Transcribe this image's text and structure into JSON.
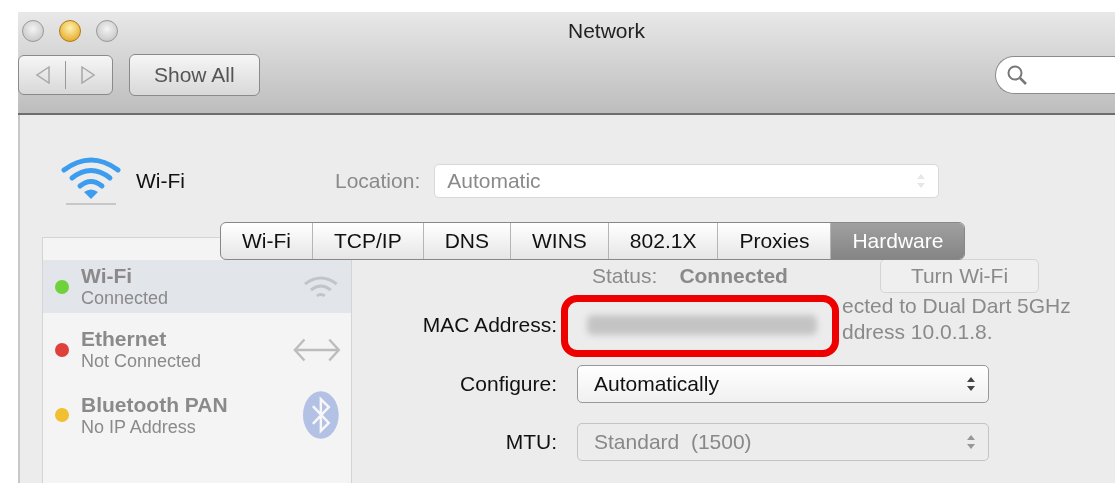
{
  "window": {
    "title": "Network"
  },
  "toolbar": {
    "show_all": "Show All"
  },
  "service": {
    "name": "Wi-Fi"
  },
  "location": {
    "label": "Location:",
    "value": "Automatic"
  },
  "services": [
    {
      "name": "Wi-Fi",
      "status": "Connected",
      "selected": true,
      "color": "#6fd13b",
      "kind": "wifi"
    },
    {
      "name": "Ethernet",
      "status": "Not Connected",
      "selected": false,
      "color": "#e0403a",
      "kind": "ethernet"
    },
    {
      "name": "Bluetooth PAN",
      "status": "No IP Address",
      "selected": false,
      "color": "#f0c030",
      "kind": "bluetooth"
    }
  ],
  "status": {
    "label": "Status:",
    "value": "Connected",
    "button": "Turn Wi-Fi"
  },
  "status_details": [
    "ected to Dual Dart 5GHz",
    "ddress 10.0.1.8."
  ],
  "tabs": [
    {
      "label": "Wi-Fi",
      "selected": false
    },
    {
      "label": "TCP/IP",
      "selected": false
    },
    {
      "label": "DNS",
      "selected": false
    },
    {
      "label": "WINS",
      "selected": false
    },
    {
      "label": "802.1X",
      "selected": false
    },
    {
      "label": "Proxies",
      "selected": false
    },
    {
      "label": "Hardware",
      "selected": true
    }
  ],
  "hardware": {
    "mac_label": "MAC Address:",
    "mac_highlighted": true,
    "configure_label": "Configure:",
    "configure_value": "Automatically",
    "configure_disabled": false,
    "mtu_label": "MTU:",
    "mtu_value": "Standard  (1500)",
    "mtu_disabled": true
  }
}
